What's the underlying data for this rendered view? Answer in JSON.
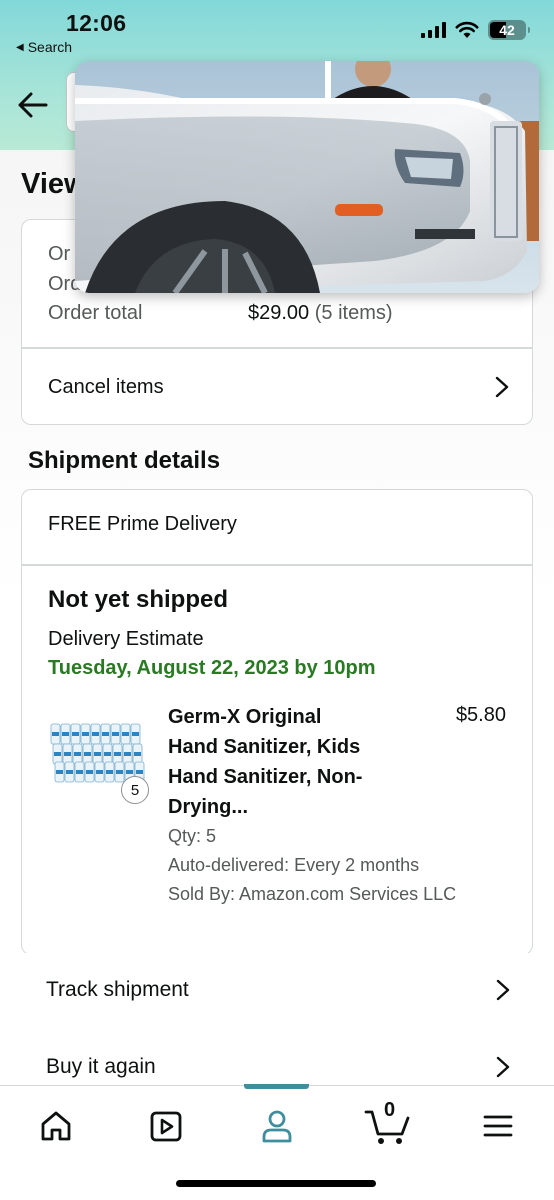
{
  "status_bar": {
    "time": "12:06",
    "back_app": "Search",
    "battery": "42"
  },
  "header": {
    "back_icon": "back-arrow-icon",
    "gradient_colors": [
      "#82d8d9",
      "#b8e9d6"
    ]
  },
  "page": {
    "title_visible": "View"
  },
  "summary": {
    "row1_label": "Or",
    "row2_label": "Ord",
    "total_label": "Order total",
    "total_amount": "$29.00",
    "total_items": "(5 items)",
    "cancel_label": "Cancel items"
  },
  "shipment": {
    "section_title": "Shipment details",
    "delivery_type": "FREE Prime Delivery",
    "status": "Not yet shipped",
    "estimate_label": "Delivery Estimate",
    "estimate_date": "Tuesday, August 22, 2023 by 10pm",
    "item": {
      "title_line1": "Germ-X Original",
      "title_line2": "Hand Sanitizer, Kids",
      "title_line3": "Hand Sanitizer, Non-",
      "title_line4": "Drying...",
      "price": "$5.80",
      "quantity_badge": "5",
      "qty": "Qty: 5",
      "auto_delivered": "Auto-delivered: Every 2 months",
      "sold_by": "Sold By: Amazon.com Services LLC"
    }
  },
  "actions": {
    "track": "Track shipment",
    "buy_again": "Buy it again"
  },
  "bottom_nav": {
    "cart_count": "0",
    "active_tab": "account",
    "accent_color": "#3f8e9d",
    "items": [
      "home-icon",
      "video-icon",
      "account-icon",
      "cart-icon",
      "menu-icon"
    ]
  },
  "colors": {
    "delivery_green": "#2a7a23",
    "secondary_text": "#565959",
    "border": "#d5d9d9"
  }
}
